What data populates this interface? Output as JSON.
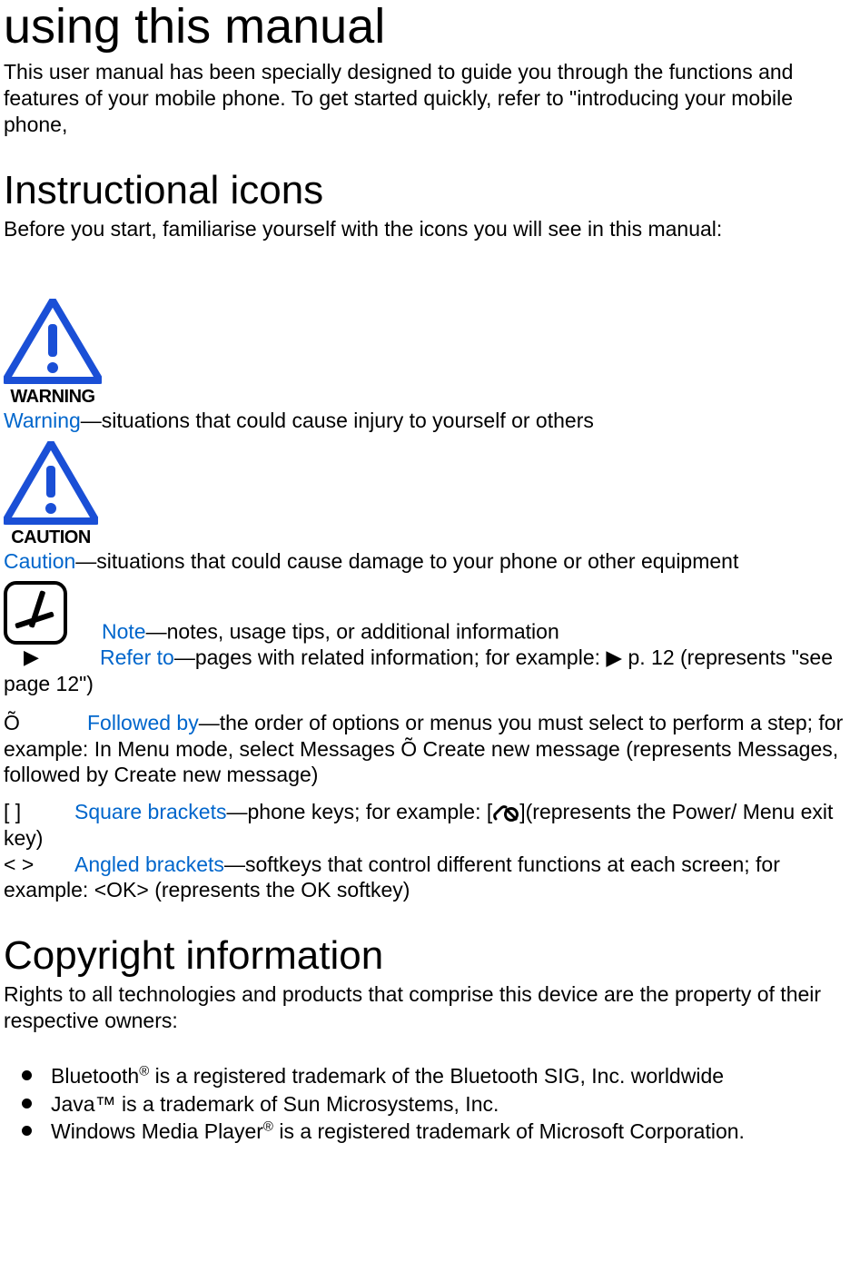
{
  "title_main": "using this manual",
  "intro_text": "This user manual has been specially designed to guide you through the functions and features of your mobile phone. To get started quickly, refer to \"introducing your mobile phone,",
  "heading_icons": "Instructional icons",
  "icons_intro": "Before you start, familiarise yourself with the icons you will see in this manual:",
  "warning_label": "Warning",
  "warning_desc": "—situations that could cause injury to yourself or others",
  "caution_label": "Caution",
  "caution_desc": "—situations that could cause damage to your phone or other equipment",
  "note_label": "Note",
  "note_desc": "—notes, usage tips, or additional information",
  "refer_arrow_symbol": "▶",
  "refer_label": "Refer to",
  "refer_desc": "—pages with related information; for example: ▶ p. 12 (represents \"see page 12\")",
  "followed_symbol": "Õ",
  "followed_label": "Followed by",
  "followed_desc": "—the order of options or menus you must select to perform a step; for example: In Menu mode, select Messages Õ Create new message (represents Messages, followed by Create new message)",
  "square_symbol": "[    ]",
  "square_label": "Square brackets",
  "square_desc_pre": "—phone keys; for example: [",
  "square_desc_post": "](represents the Power/ Menu exit key)",
  "angled_symbol": "<    >",
  "angled_label": "Angled brackets",
  "angled_desc": "—softkeys that control different functions at each screen; for example: <OK> (represents the OK softkey)",
  "heading_copyright": "Copyright information",
  "copyright_intro": "Rights to all technologies and products that comprise this device are the property of their respective owners:",
  "bullet1_pre": "Bluetooth",
  "bullet1_sup": "®",
  "bullet1_post": " is a registered trademark of the Bluetooth SIG, Inc. worldwide",
  "bullet2": "Java™ is a trademark of Sun Microsystems, Inc.",
  "bullet3_pre": "Windows Media Player",
  "bullet3_sup": "®",
  "bullet3_post": " is a registered trademark of Microsoft Corporation."
}
